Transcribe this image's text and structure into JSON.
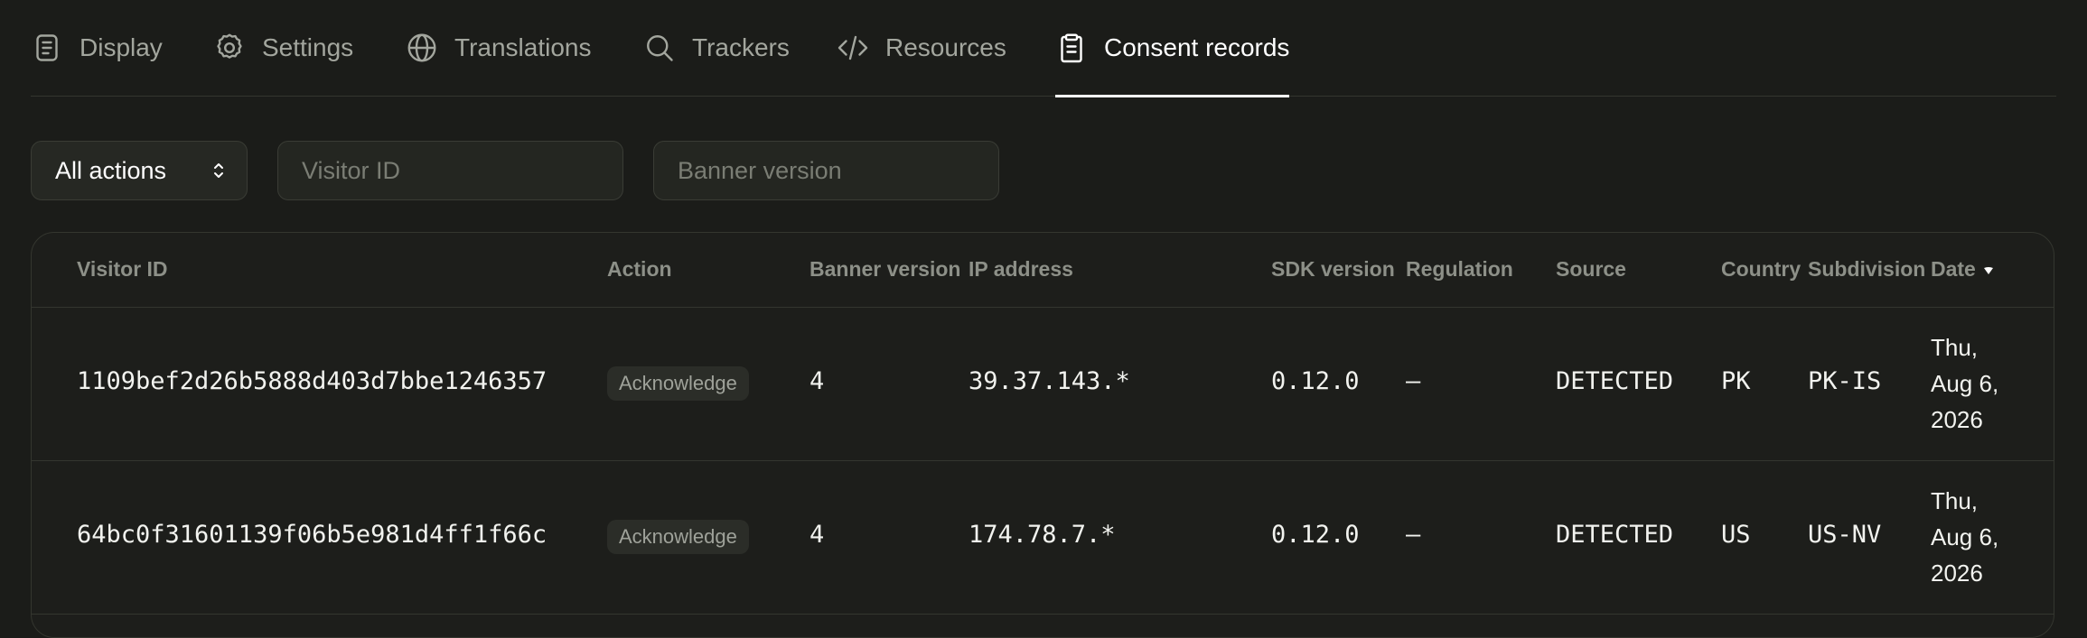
{
  "tabs": [
    {
      "label": "Display",
      "icon": "document-icon",
      "active": false
    },
    {
      "label": "Settings",
      "icon": "gear-icon",
      "active": false
    },
    {
      "label": "Translations",
      "icon": "globe-icon",
      "active": false
    },
    {
      "label": "Trackers",
      "icon": "search-icon",
      "active": false
    },
    {
      "label": "Resources",
      "icon": "code-icon",
      "active": false
    },
    {
      "label": "Consent records",
      "icon": "clipboard-icon",
      "active": true
    }
  ],
  "filters": {
    "action_select": "All actions",
    "visitor_placeholder": "Visitor ID",
    "banner_placeholder": "Banner version"
  },
  "table": {
    "columns": [
      "Visitor ID",
      "Action",
      "Banner version",
      "IP address",
      "SDK version",
      "Regulation",
      "Source",
      "Country",
      "Subdivision",
      "Date"
    ],
    "sort": {
      "column": "Date",
      "direction": "desc"
    },
    "rows": [
      {
        "visitor_id": "1109bef2d26b5888d403d7bbe1246357",
        "action": "Acknowledge",
        "banner_version": "4",
        "ip_address": "39.37.143.*",
        "sdk_version": "0.12.0",
        "regulation": "–",
        "source": "DETECTED",
        "country": "PK",
        "subdivision": "PK-IS",
        "date_lines": [
          "Thu,",
          "Aug 6,",
          "2026"
        ]
      },
      {
        "visitor_id": "64bc0f31601139f06b5e981d4ff1f66c",
        "action": "Acknowledge",
        "banner_version": "4",
        "ip_address": "174.78.7.*",
        "sdk_version": "0.12.0",
        "regulation": "–",
        "source": "DETECTED",
        "country": "US",
        "subdivision": "US-NV",
        "date_lines": [
          "Thu,",
          "Aug 6,",
          "2026"
        ]
      }
    ]
  }
}
